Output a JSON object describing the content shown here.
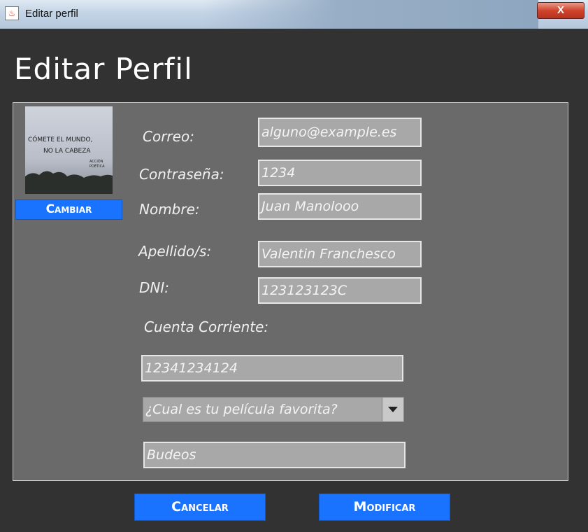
{
  "window": {
    "title": "Editar perfil",
    "close_label": "X"
  },
  "page": {
    "heading": "Editar Perfil"
  },
  "profile_photo": {
    "caption_line1": "CÓMETE EL MUNDO,",
    "caption_line2": "NO LA CABEZA",
    "caption_sub1": "ACCIÓN",
    "caption_sub2": "POÉTICA",
    "change_button": "Cambiar"
  },
  "form": {
    "correo": {
      "label": "Correo:",
      "value": "alguno@example.es"
    },
    "contrasena": {
      "label": "Contraseña:",
      "value": "1234"
    },
    "nombre": {
      "label": "Nombre:",
      "value": "Juan Manolooo"
    },
    "apellidos": {
      "label": "Apellido/s:",
      "value": "Valentin Franchesco"
    },
    "dni": {
      "label": "DNI:",
      "value": "123123123C"
    },
    "cuenta": {
      "label": "Cuenta Corriente:",
      "value": "12341234124"
    },
    "pregunta": {
      "selected": "¿Cual es tu película favorita?"
    },
    "respuesta": {
      "value": "Budeos"
    }
  },
  "actions": {
    "cancel": "Cancelar",
    "submit": "Modificar"
  },
  "colors": {
    "background": "#323232",
    "panel": "#6a6a6a",
    "field": "#a8a8a8",
    "accent": "#1a73ff"
  }
}
